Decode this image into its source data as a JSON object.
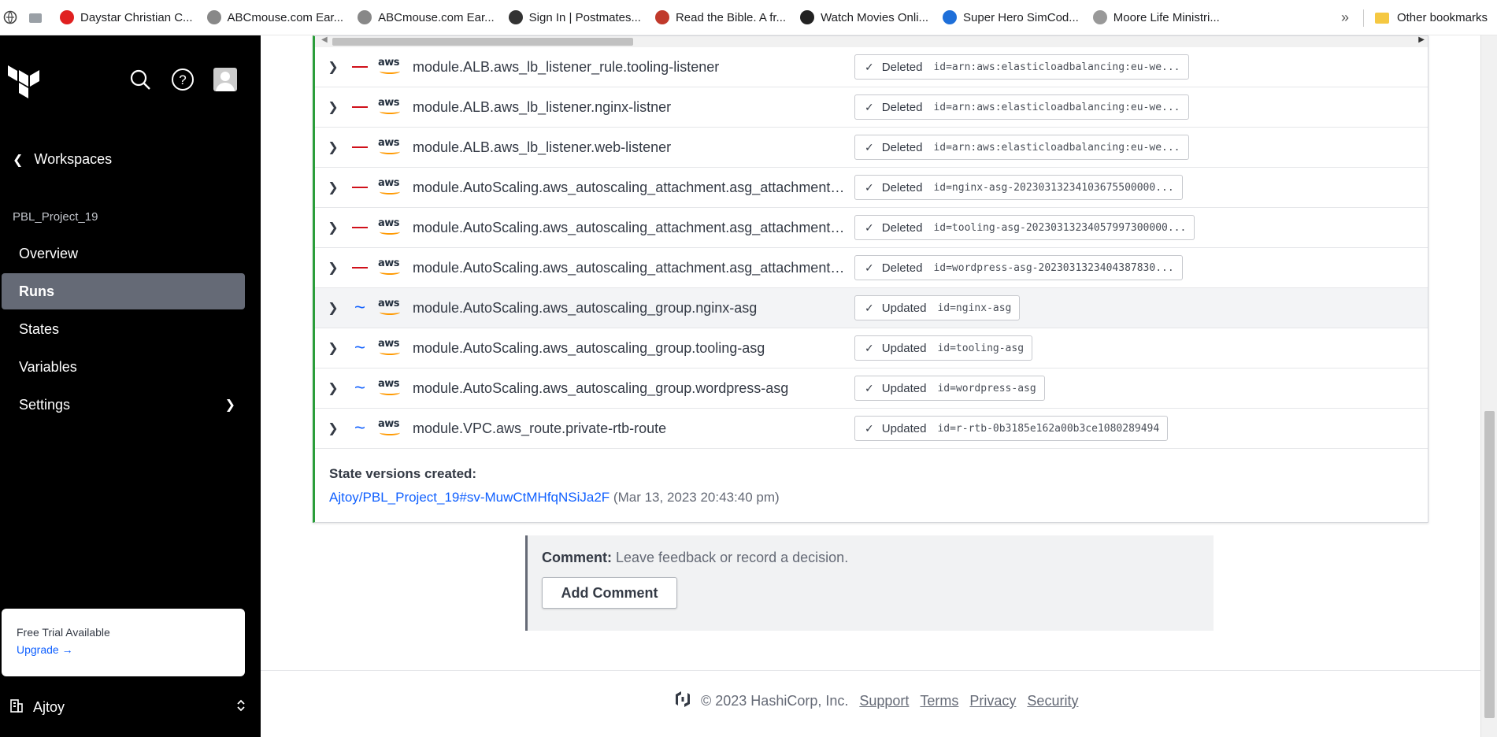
{
  "bookmarks": {
    "items": [
      {
        "label": "Daystar Christian C...",
        "color": "#e02020"
      },
      {
        "label": "ABCmouse.com Ear...",
        "color": "#888888"
      },
      {
        "label": "ABCmouse.com Ear...",
        "color": "#888888"
      },
      {
        "label": "Sign In | Postmates...",
        "color": "#333333"
      },
      {
        "label": "Read the Bible. A fr...",
        "color": "#c0392b"
      },
      {
        "label": "Watch Movies Onli...",
        "color": "#222222"
      },
      {
        "label": "Super Hero SimCod...",
        "color": "#1e6fd9"
      },
      {
        "label": "Moore Life Ministri...",
        "color": "#999999"
      }
    ],
    "overflow": "»",
    "other": "Other bookmarks"
  },
  "sidebar": {
    "back_label": "Workspaces",
    "project": "PBL_Project_19",
    "nav": [
      {
        "label": "Overview",
        "active": false
      },
      {
        "label": "Runs",
        "active": true
      },
      {
        "label": "States",
        "active": false
      },
      {
        "label": "Variables",
        "active": false
      },
      {
        "label": "Settings",
        "active": false
      }
    ],
    "trial_title": "Free Trial Available",
    "trial_link": "Upgrade",
    "account": "Ajtoy"
  },
  "resources": [
    {
      "action": "delete",
      "name": "module.ALB.aws_lb_listener_rule.tooling-listener",
      "status": "Deleted",
      "id": "id=arn:aws:elasticloadbalancing:eu-we..."
    },
    {
      "action": "delete",
      "name": "module.ALB.aws_lb_listener.nginx-listner",
      "status": "Deleted",
      "id": "id=arn:aws:elasticloadbalancing:eu-we..."
    },
    {
      "action": "delete",
      "name": "module.ALB.aws_lb_listener.web-listener",
      "status": "Deleted",
      "id": "id=arn:aws:elasticloadbalancing:eu-we..."
    },
    {
      "action": "delete",
      "name": "module.AutoScaling.aws_autoscaling_attachment.asg_attachment_n...",
      "status": "Deleted",
      "id": "id=nginx-asg-20230313234103675500000..."
    },
    {
      "action": "delete",
      "name": "module.AutoScaling.aws_autoscaling_attachment.asg_attachment_to...",
      "status": "Deleted",
      "id": "id=tooling-asg-20230313234057997300000..."
    },
    {
      "action": "delete",
      "name": "module.AutoScaling.aws_autoscaling_attachment.asg_attachment_w...",
      "status": "Deleted",
      "id": "id=wordpress-asg-2023031323404387830..."
    },
    {
      "action": "update",
      "name": "module.AutoScaling.aws_autoscaling_group.nginx-asg",
      "status": "Updated",
      "id": "id=nginx-asg",
      "highlight": true
    },
    {
      "action": "update",
      "name": "module.AutoScaling.aws_autoscaling_group.tooling-asg",
      "status": "Updated",
      "id": "id=tooling-asg"
    },
    {
      "action": "update",
      "name": "module.AutoScaling.aws_autoscaling_group.wordpress-asg",
      "status": "Updated",
      "id": "id=wordpress-asg"
    },
    {
      "action": "update",
      "name": "module.VPC.aws_route.private-rtb-route",
      "status": "Updated",
      "id": "id=r-rtb-0b3185e162a00b3ce1080289494"
    }
  ],
  "state_versions": {
    "heading": "State versions created:",
    "link": "Ajtoy/PBL_Project_19#sv-MuwCtMHfqNSiJa2F",
    "time": "(Mar 13, 2023 20:43:40 pm)"
  },
  "comment": {
    "label": "Comment:",
    "placeholder": "Leave feedback or record a decision.",
    "button": "Add Comment"
  },
  "footer": {
    "copyright": "© 2023 HashiCorp, Inc.",
    "links": [
      "Support",
      "Terms",
      "Privacy",
      "Security"
    ]
  },
  "colors": {
    "delete": "#d0101a",
    "update": "#1060ff",
    "applied_border": "#2a9d3a",
    "active_nav": "#656a76"
  }
}
